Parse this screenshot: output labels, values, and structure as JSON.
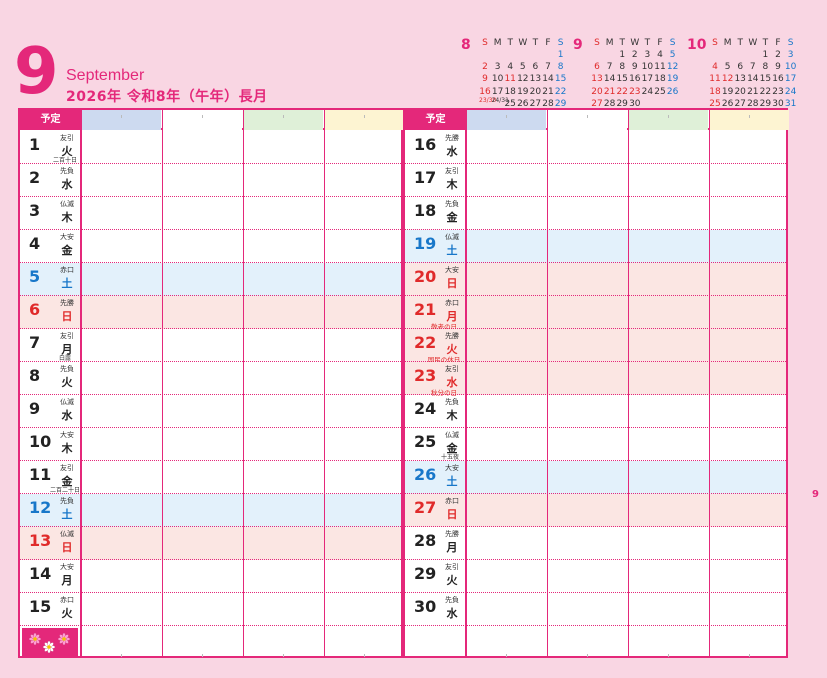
{
  "header": {
    "month_number": "9",
    "month_name": "September",
    "year_line": "2026年 令和8年（午年）長月"
  },
  "mini_calendars": [
    {
      "month": "8",
      "weekdays": [
        "S",
        "M",
        "T",
        "W",
        "T",
        "F",
        "S"
      ],
      "rows": [
        [
          "",
          "",
          "",
          "",
          "",
          "",
          "1"
        ],
        [
          "2",
          "3",
          "4",
          "5",
          "6",
          "7",
          "8"
        ],
        [
          "9",
          "10",
          "11",
          "12",
          "13",
          "14",
          "15"
        ],
        [
          "16",
          "17",
          "18",
          "19",
          "20",
          "21",
          "22"
        ],
        [
          "23/30",
          "24/31",
          "25",
          "26",
          "27",
          "28",
          "29"
        ]
      ],
      "holiday_days": [
        "11"
      ]
    },
    {
      "month": "9",
      "weekdays": [
        "S",
        "M",
        "T",
        "W",
        "T",
        "F",
        "S"
      ],
      "rows": [
        [
          "",
          "",
          "1",
          "2",
          "3",
          "4",
          "5"
        ],
        [
          "6",
          "7",
          "8",
          "9",
          "10",
          "11",
          "12"
        ],
        [
          "13",
          "14",
          "15",
          "16",
          "17",
          "18",
          "19"
        ],
        [
          "20",
          "21",
          "22",
          "23",
          "24",
          "25",
          "26"
        ],
        [
          "27",
          "28",
          "29",
          "30",
          "",
          "",
          ""
        ]
      ],
      "holiday_days": [
        "21",
        "22",
        "23"
      ]
    },
    {
      "month": "10",
      "weekdays": [
        "S",
        "M",
        "T",
        "W",
        "T",
        "F",
        "S"
      ],
      "rows": [
        [
          "",
          "",
          "",
          "",
          "1",
          "2",
          "3"
        ],
        [
          "4",
          "5",
          "6",
          "7",
          "8",
          "9",
          "10"
        ],
        [
          "11",
          "12",
          "13",
          "14",
          "15",
          "16",
          "17"
        ],
        [
          "18",
          "19",
          "20",
          "21",
          "22",
          "23",
          "24"
        ],
        [
          "25",
          "26",
          "27",
          "28",
          "29",
          "30",
          "31"
        ]
      ],
      "holiday_days": [
        "12"
      ]
    }
  ],
  "planner": {
    "header_label": "予定",
    "swatch_colors": [
      "#cddaf0",
      "#ffffff",
      "#dff0d8",
      "#fdf4d2"
    ],
    "accent_color": "#e4287a",
    "left_days": [
      {
        "day": "1",
        "weekday": "火",
        "rokuyo": "友引",
        "note": "二百十日",
        "type": "normal",
        "holiday": ""
      },
      {
        "day": "2",
        "weekday": "水",
        "rokuyo": "先負",
        "note": "",
        "type": "normal",
        "holiday": ""
      },
      {
        "day": "3",
        "weekday": "木",
        "rokuyo": "仏滅",
        "note": "",
        "type": "normal",
        "holiday": ""
      },
      {
        "day": "4",
        "weekday": "金",
        "rokuyo": "大安",
        "note": "",
        "type": "normal",
        "holiday": ""
      },
      {
        "day": "5",
        "weekday": "土",
        "rokuyo": "赤口",
        "note": "",
        "type": "sat",
        "holiday": ""
      },
      {
        "day": "6",
        "weekday": "日",
        "rokuyo": "先勝",
        "note": "",
        "type": "sun",
        "holiday": ""
      },
      {
        "day": "7",
        "weekday": "月",
        "rokuyo": "友引",
        "note": "白露",
        "type": "normal",
        "holiday": ""
      },
      {
        "day": "8",
        "weekday": "火",
        "rokuyo": "先負",
        "note": "",
        "type": "normal",
        "holiday": ""
      },
      {
        "day": "9",
        "weekday": "水",
        "rokuyo": "仏滅",
        "note": "",
        "type": "normal",
        "holiday": ""
      },
      {
        "day": "10",
        "weekday": "木",
        "rokuyo": "大安",
        "note": "",
        "type": "normal",
        "holiday": ""
      },
      {
        "day": "11",
        "weekday": "金",
        "rokuyo": "友引",
        "note": "二百二十日",
        "type": "normal",
        "holiday": ""
      },
      {
        "day": "12",
        "weekday": "土",
        "rokuyo": "先負",
        "note": "",
        "type": "sat",
        "holiday": ""
      },
      {
        "day": "13",
        "weekday": "日",
        "rokuyo": "仏滅",
        "note": "",
        "type": "sun",
        "holiday": ""
      },
      {
        "day": "14",
        "weekday": "月",
        "rokuyo": "大安",
        "note": "",
        "type": "normal",
        "holiday": ""
      },
      {
        "day": "15",
        "weekday": "火",
        "rokuyo": "赤口",
        "note": "",
        "type": "normal",
        "holiday": ""
      }
    ],
    "right_days": [
      {
        "day": "16",
        "weekday": "水",
        "rokuyo": "先勝",
        "note": "",
        "type": "normal",
        "holiday": ""
      },
      {
        "day": "17",
        "weekday": "木",
        "rokuyo": "友引",
        "note": "",
        "type": "normal",
        "holiday": ""
      },
      {
        "day": "18",
        "weekday": "金",
        "rokuyo": "先負",
        "note": "",
        "type": "normal",
        "holiday": ""
      },
      {
        "day": "19",
        "weekday": "土",
        "rokuyo": "仏滅",
        "note": "",
        "type": "sat",
        "holiday": ""
      },
      {
        "day": "20",
        "weekday": "日",
        "rokuyo": "大安",
        "note": "",
        "type": "sun",
        "holiday": ""
      },
      {
        "day": "21",
        "weekday": "月",
        "rokuyo": "赤口",
        "note": "",
        "type": "hol",
        "holiday": "敬老の日"
      },
      {
        "day": "22",
        "weekday": "火",
        "rokuyo": "先勝",
        "note": "",
        "type": "hol",
        "holiday": "国民の休日"
      },
      {
        "day": "23",
        "weekday": "水",
        "rokuyo": "友引",
        "note": "",
        "type": "hol",
        "holiday": "秋分の日"
      },
      {
        "day": "24",
        "weekday": "木",
        "rokuyo": "先負",
        "note": "",
        "type": "normal",
        "holiday": ""
      },
      {
        "day": "25",
        "weekday": "金",
        "rokuyo": "仏滅",
        "note": "十五夜",
        "type": "normal",
        "holiday": ""
      },
      {
        "day": "26",
        "weekday": "土",
        "rokuyo": "大安",
        "note": "",
        "type": "sat",
        "holiday": ""
      },
      {
        "day": "27",
        "weekday": "日",
        "rokuyo": "赤口",
        "note": "",
        "type": "sun",
        "holiday": ""
      },
      {
        "day": "28",
        "weekday": "月",
        "rokuyo": "先勝",
        "note": "",
        "type": "normal",
        "holiday": ""
      },
      {
        "day": "29",
        "weekday": "火",
        "rokuyo": "友引",
        "note": "",
        "type": "normal",
        "holiday": ""
      },
      {
        "day": "30",
        "weekday": "水",
        "rokuyo": "先負",
        "note": "",
        "type": "normal",
        "holiday": ""
      }
    ]
  },
  "page_number": "9"
}
